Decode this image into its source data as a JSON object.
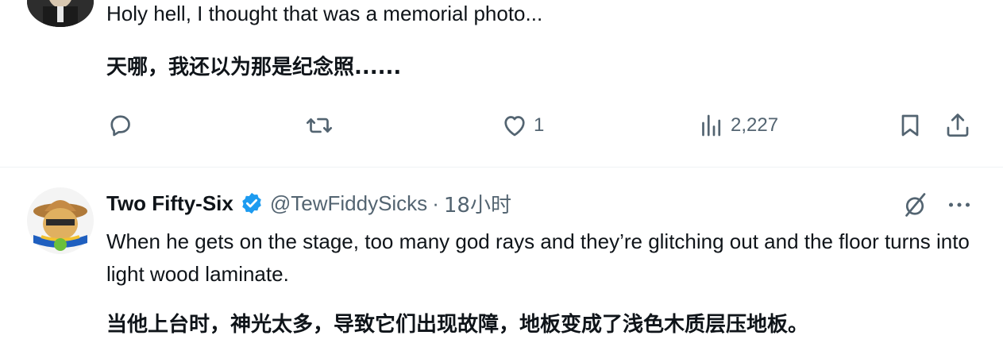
{
  "tweet1": {
    "text_en": "Holy hell, I thought that was a memorial photo...",
    "text_zh": "天哪，我还以为那是纪念照......",
    "actions": {
      "reply_count": "",
      "retweet_count": "",
      "like_count": "1",
      "views_count": "2,227"
    }
  },
  "tweet2": {
    "display_name": "Two Fifty-Six",
    "handle": "@TewFiddySicks",
    "separator": "·",
    "time": "18小时",
    "text_en": "When he gets on the stage, too many god rays and they’re glitching out and the floor turns into light wood laminate.",
    "text_zh": "当他上台时，神光太多，导致它们出现故障，地板变成了浅色木质层压地板。"
  },
  "colors": {
    "text_primary": "#0f1419",
    "text_secondary": "#536471",
    "verified_blue": "#1d9bf0",
    "divider": "#eff3f4"
  },
  "icons": [
    "reply-icon",
    "retweet-icon",
    "like-icon",
    "views-icon",
    "bookmark-icon",
    "share-icon",
    "verified-badge-icon",
    "grok-icon",
    "more-icon"
  ]
}
